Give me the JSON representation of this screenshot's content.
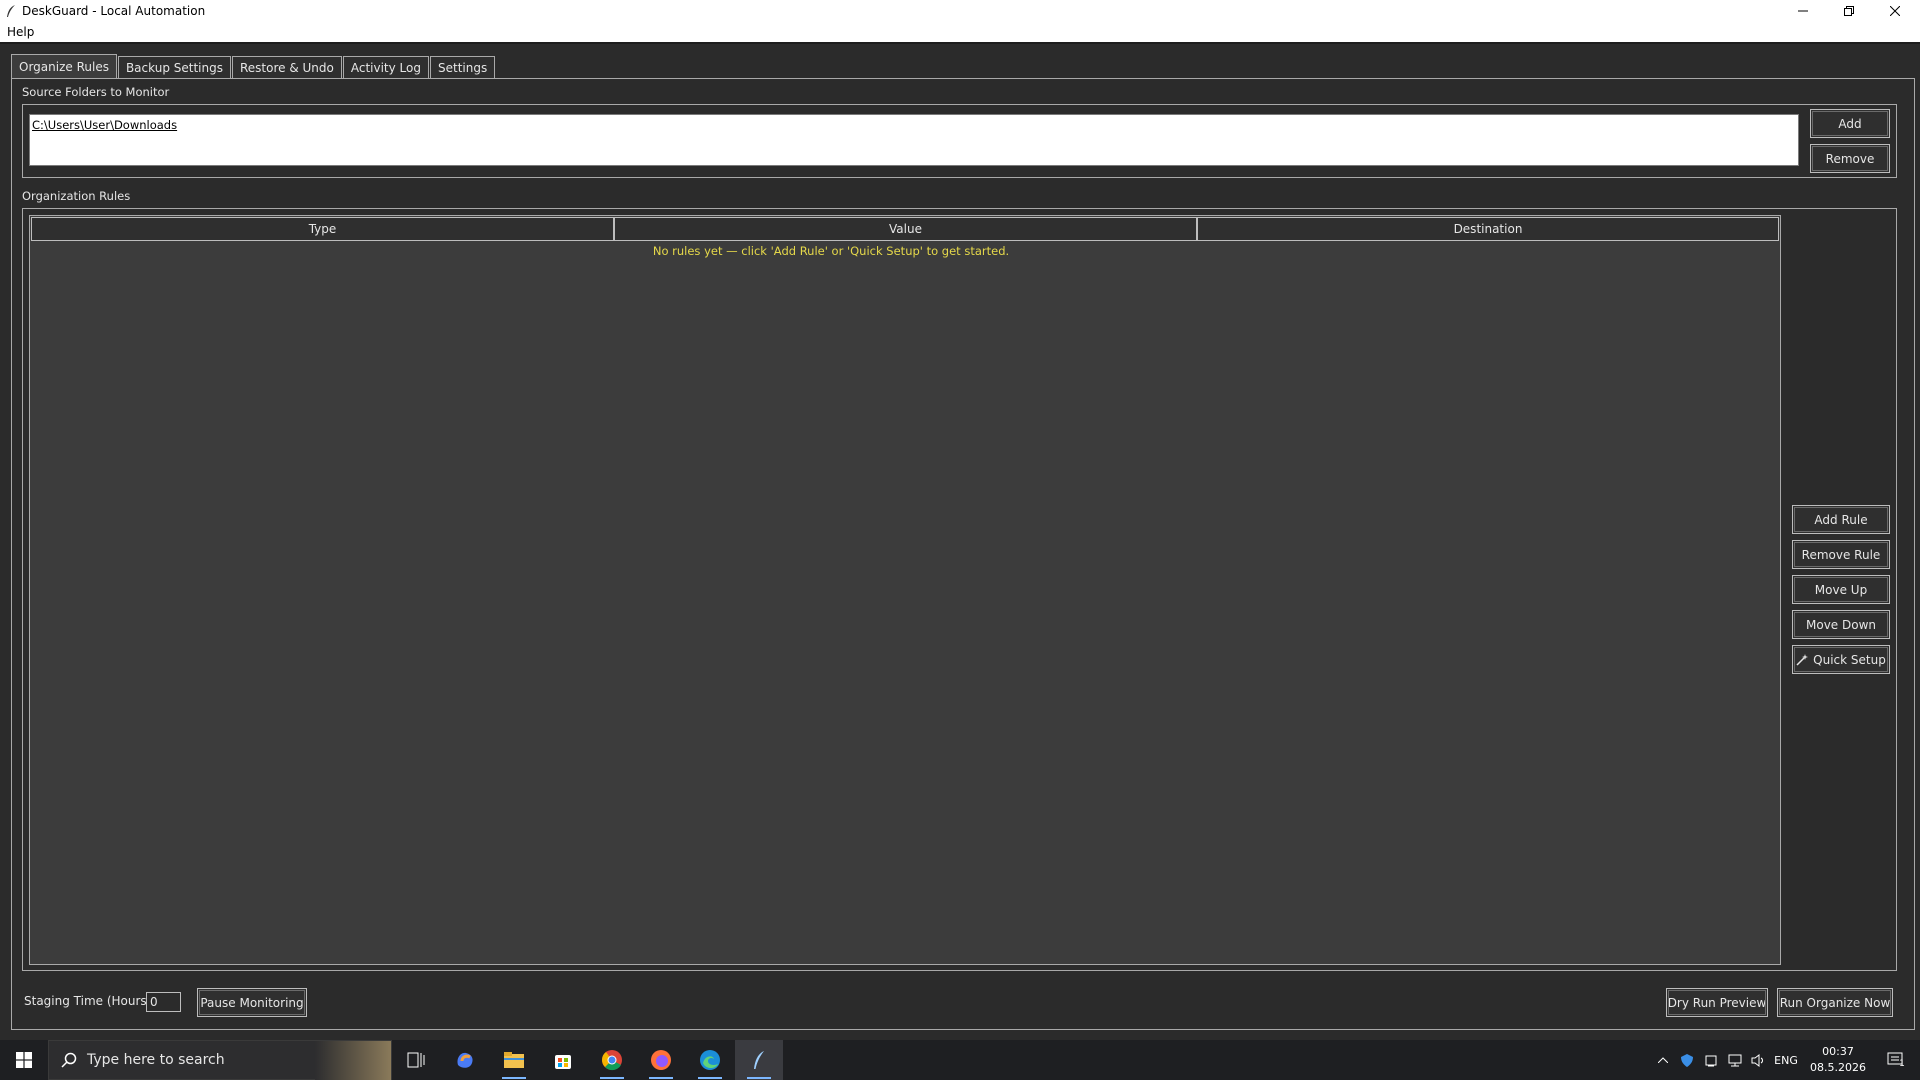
{
  "window": {
    "title": "DeskGuard - Local Automation"
  },
  "menu": {
    "items": [
      "Help"
    ]
  },
  "tabs": [
    "Organize Rules",
    "Backup Settings",
    "Restore & Undo",
    "Activity Log",
    "Settings"
  ],
  "source_folders": {
    "label": "Source Folders to Monitor",
    "folders": [
      "C:\\Users\\User\\Downloads"
    ],
    "add_label": "Add",
    "remove_label": "Remove"
  },
  "rules": {
    "label": "Organization Rules",
    "columns": [
      "Type",
      "Value",
      "Destination"
    ],
    "empty_message": "No rules yet — click 'Add Rule' or 'Quick Setup' to get started.",
    "buttons": {
      "add_rule": "Add Rule",
      "remove_rule": "Remove Rule",
      "move_up": "Move Up",
      "move_down": "Move Down",
      "quick_setup": "Quick Setup"
    }
  },
  "footer": {
    "staging_label": "Staging Time (Hours):",
    "staging_value": "0",
    "pause_label": "Pause Monitoring",
    "dry_run_label": "Dry Run Preview",
    "run_now_label": "Run Organize Now"
  },
  "taskbar": {
    "search_placeholder": "Type here to search",
    "language": "ENG",
    "time": "00:37",
    "date": "08.5.2026",
    "notification_count": "1"
  }
}
